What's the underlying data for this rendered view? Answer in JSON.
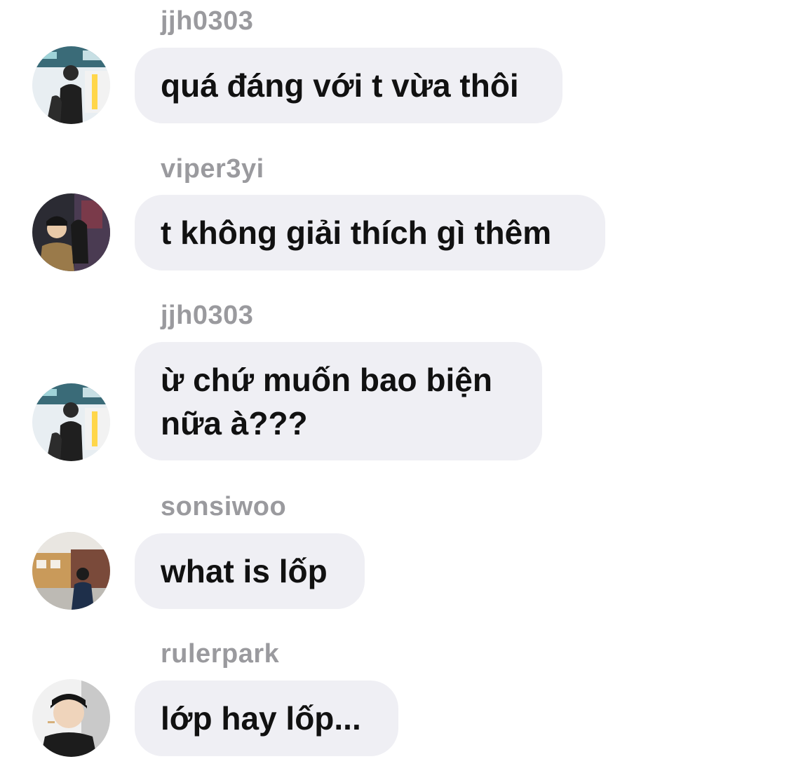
{
  "messages": [
    {
      "username": "jjh0303",
      "text": "quá đáng với t vừa thôi",
      "avatar": "avatar-jjh0303"
    },
    {
      "username": "viper3yi",
      "text": "t không giải thích gì thêm",
      "avatar": "avatar-viper3yi"
    },
    {
      "username": "jjh0303",
      "text": "ừ chứ muốn bao biện\nnữa à???",
      "avatar": "avatar-jjh0303"
    },
    {
      "username": "sonsiwoo",
      "text": "what is lốp",
      "avatar": "avatar-sonsiwoo"
    },
    {
      "username": "rulerpark",
      "text": "lớp hay lốp...",
      "avatar": "avatar-rulerpark"
    }
  ],
  "colors": {
    "bubble": "#efeff4",
    "username": "#9a9a9e",
    "text": "#111111"
  }
}
